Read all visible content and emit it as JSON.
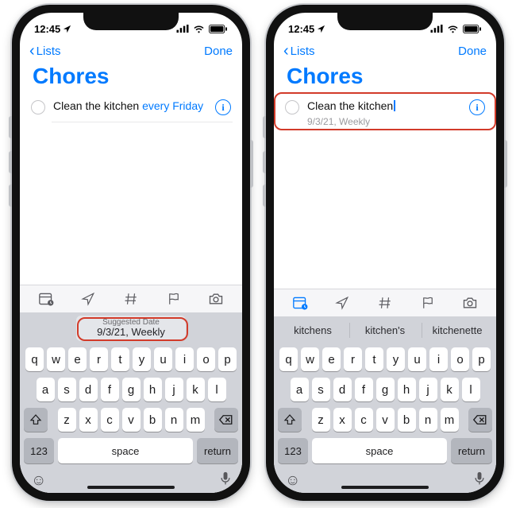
{
  "status": {
    "time": "12:45",
    "loc_icon": "location-arrow"
  },
  "nav": {
    "back": "Lists",
    "done": "Done"
  },
  "list_title": "Chores",
  "left": {
    "reminder_text": "Clean the kitchen ",
    "reminder_nl": "every Friday",
    "suggested_label": "Suggested Date",
    "suggested_value": "9/3/21, Weekly"
  },
  "right": {
    "reminder_text": "Clean the kitchen",
    "subline": "9/3/21, Weekly",
    "predictions": [
      "kitchens",
      "kitchen's",
      "kitchenette"
    ]
  },
  "keyboard": {
    "row1": [
      "q",
      "w",
      "e",
      "r",
      "t",
      "y",
      "u",
      "i",
      "o",
      "p"
    ],
    "row2": [
      "a",
      "s",
      "d",
      "f",
      "g",
      "h",
      "j",
      "k",
      "l"
    ],
    "row3": [
      "z",
      "x",
      "c",
      "v",
      "b",
      "n",
      "m"
    ],
    "numkey": "123",
    "space": "space",
    "return": "return"
  }
}
